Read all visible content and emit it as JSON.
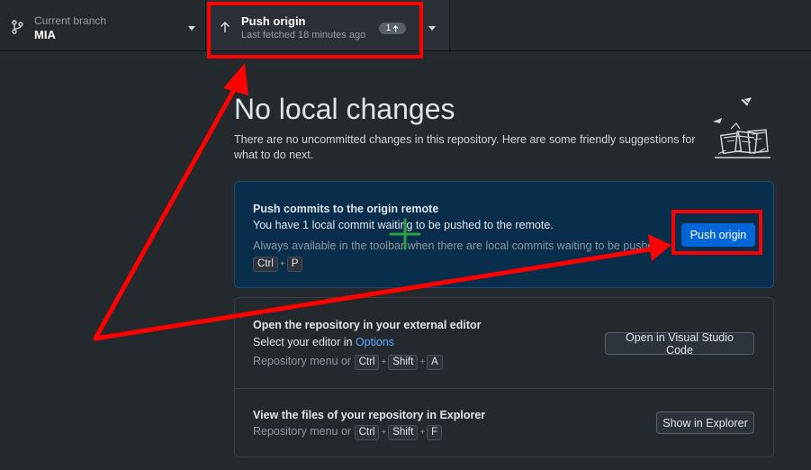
{
  "toolbar": {
    "branch": {
      "label": "Current branch",
      "name": "MIA",
      "icon": "git-branch-icon"
    },
    "push": {
      "title": "Push origin",
      "subtitle": "Last fetched 18 minutes ago",
      "badge_count": "1",
      "badge_icon": "arrow-up-icon"
    }
  },
  "main": {
    "heading": "No local changes",
    "description": "There are no uncommitted changes in this repository. Here are some friendly suggestions for what to do next.",
    "push_card": {
      "title": "Push commits to the origin remote",
      "text": "You have 1 local commit waiting to be pushed to the remote.",
      "hint": "Always available in the toolbar when there are local commits waiting to be pushed or",
      "shortcut": [
        "Ctrl",
        "P"
      ],
      "button": "Push origin"
    },
    "editor_card": {
      "title": "Open the repository in your external editor",
      "text_prefix": "Select your editor in ",
      "text_link": "Options",
      "hint_prefix": "Repository menu or",
      "shortcut": [
        "Ctrl",
        "Shift",
        "A"
      ],
      "button": "Open in Visual Studio Code"
    },
    "explorer_card": {
      "title": "View the files of your repository in Explorer",
      "hint_prefix": "Repository menu or",
      "shortcut": [
        "Ctrl",
        "Shift",
        "F"
      ],
      "button": "Show in Explorer"
    }
  },
  "colors": {
    "annotation": "#ff0000",
    "crosshair": "#2ea043",
    "accent": "#0366d6"
  }
}
